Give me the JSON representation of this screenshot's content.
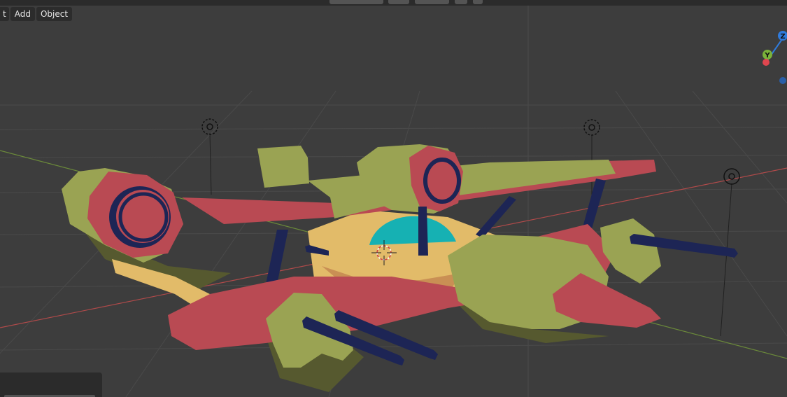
{
  "header": {
    "menus": [
      {
        "label": "t"
      },
      {
        "label": "Add"
      },
      {
        "label": "Object"
      }
    ]
  },
  "gizmo": {
    "z_label": "Z",
    "y_label": "Y",
    "x_color": "#e0464f",
    "y_color": "#7ab23a",
    "z_color": "#2f7bdc"
  },
  "scene": {
    "background": "#3d3d3d",
    "grid_color": "#4a4a4a",
    "x_axis_color": "#b04a4a",
    "y_axis_color": "#6b8a3a",
    "model_colors": {
      "olive": "#9aa353",
      "red": "#b94a53",
      "tan": "#e2bb69",
      "navy": "#1d2555",
      "cyan": "#16b1b3"
    }
  }
}
